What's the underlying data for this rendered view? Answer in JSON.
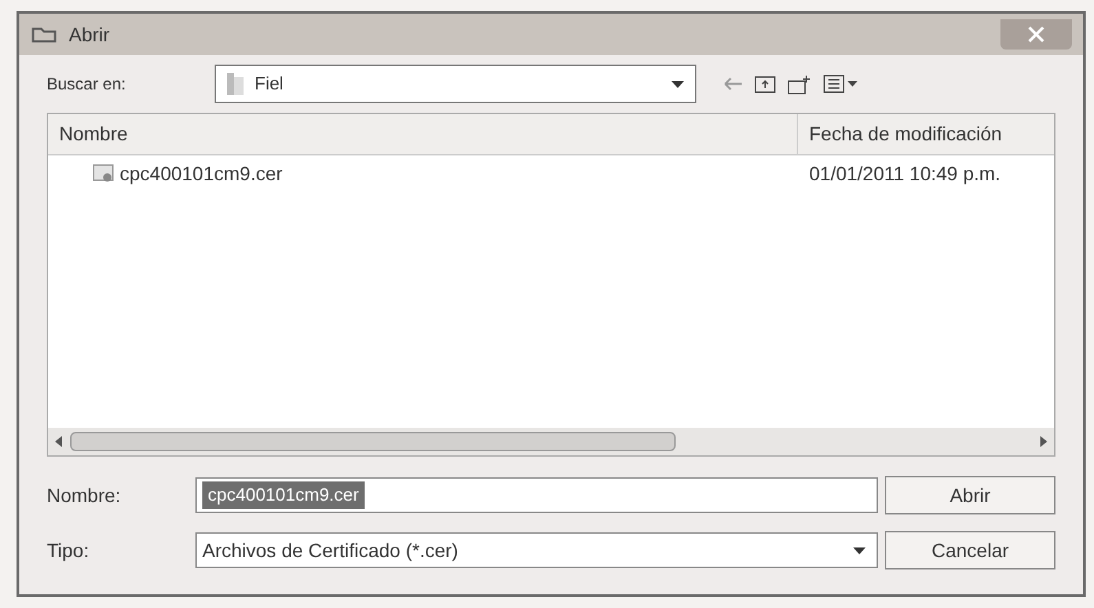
{
  "window": {
    "title": "Abrir"
  },
  "look_in": {
    "label": "Buscar en:",
    "value": "Fiel"
  },
  "file_list": {
    "columns": [
      "Nombre",
      "Fecha de modificación"
    ],
    "rows": [
      {
        "name": "cpc400101cm9.cer",
        "date": "01/01/2011 10:49 p.m."
      }
    ]
  },
  "file_name": {
    "label": "Nombre:",
    "value": "cpc400101cm9.cer",
    "selected": true
  },
  "file_type": {
    "label": "Tipo:",
    "value": "Archivos de Certificado (*.cer)"
  },
  "buttons": [
    "Abrir",
    "Cancelar"
  ]
}
